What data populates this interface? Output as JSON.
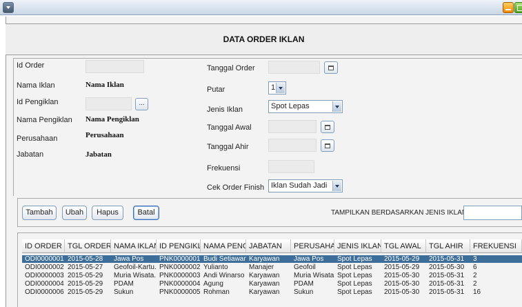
{
  "header": {
    "title": "DATA ORDER IKLAN"
  },
  "form": {
    "left": {
      "id_order_label": "Id Order",
      "nama_iklan_label": "Nama Iklan",
      "nama_iklan_value": "Nama Iklan",
      "id_pengiklan_label": "Id Pengiklan",
      "id_pengiklan_button": "...",
      "nama_pengiklan_label": "Nama Pengiklan",
      "nama_pengiklan_value": "Nama Pengiklan",
      "perusahaan_label": "Perusahaan",
      "perusahaan_value": "Perusahaan",
      "jabatan_label": "Jabatan",
      "jabatan_value": "Jabatan"
    },
    "right": {
      "tanggal_order_label": "Tanggal Order",
      "putar_label": "Putar",
      "putar_value": "1",
      "jenis_iklan_label": "Jenis Iklan",
      "jenis_iklan_value": "Spot Lepas",
      "tanggal_awal_label": "Tanggal Awal",
      "tanggal_ahir_label": "Tanggal Ahir",
      "frekuensi_label": "Frekuensi",
      "cek_order_label": "Cek Order Finish",
      "cek_order_value": "Iklan Sudah Jadi"
    }
  },
  "actions": {
    "tambah": "Tambah",
    "ubah": "Ubah",
    "hapus": "Hapus",
    "batal": "Batal",
    "filter_label": "TAMPILKAN BERDASARKAN JENIS IKLAN :"
  },
  "table": {
    "columns": [
      "ID ORDER",
      "TGL ORDER",
      "NAMA IKLAN",
      "ID PENGIKL...",
      "NAMA PENGI...",
      "JABATAN",
      "PERUSAHAAN",
      "JENIS IKLAN",
      "TGL AWAL",
      "TGL AHIR",
      "FREKUENSI"
    ],
    "rows": [
      [
        "ODI0000001",
        "2015-05-28",
        "Jawa Pos",
        "PNK0000001",
        "Budi Setiawan",
        "Karyawan",
        "Jawa Pos",
        "Spot Lepas",
        "2015-05-29",
        "2015-05-31",
        "3"
      ],
      [
        "ODI0000002",
        "2015-05-27",
        "Geofoil-Kartu...",
        "PNK0000002",
        "Yulianto",
        "Manajer",
        "Geofoil",
        "Spot Lepas",
        "2015-05-29",
        "2015-05-30",
        "6"
      ],
      [
        "ODI0000003",
        "2015-05-29",
        "Muria Wisata...",
        "PNK0000003",
        "Andi Winarso",
        "Karyawan",
        "Muria Wisata",
        "Spot Lepas",
        "2015-05-30",
        "2015-05-31",
        "2"
      ],
      [
        "ODI0000004",
        "2015-05-29",
        "PDAM",
        "PNK0000004",
        "Agung",
        "Karyawan",
        "PDAM",
        "Spot Lepas",
        "2015-05-30",
        "2015-05-31",
        "2"
      ],
      [
        "ODI0000006",
        "2015-05-29",
        "Sukun",
        "PNK0000005",
        "Rohman",
        "Karyawan",
        "Sukun",
        "Spot Lepas",
        "2015-05-30",
        "2015-05-31",
        "16"
      ]
    ]
  }
}
